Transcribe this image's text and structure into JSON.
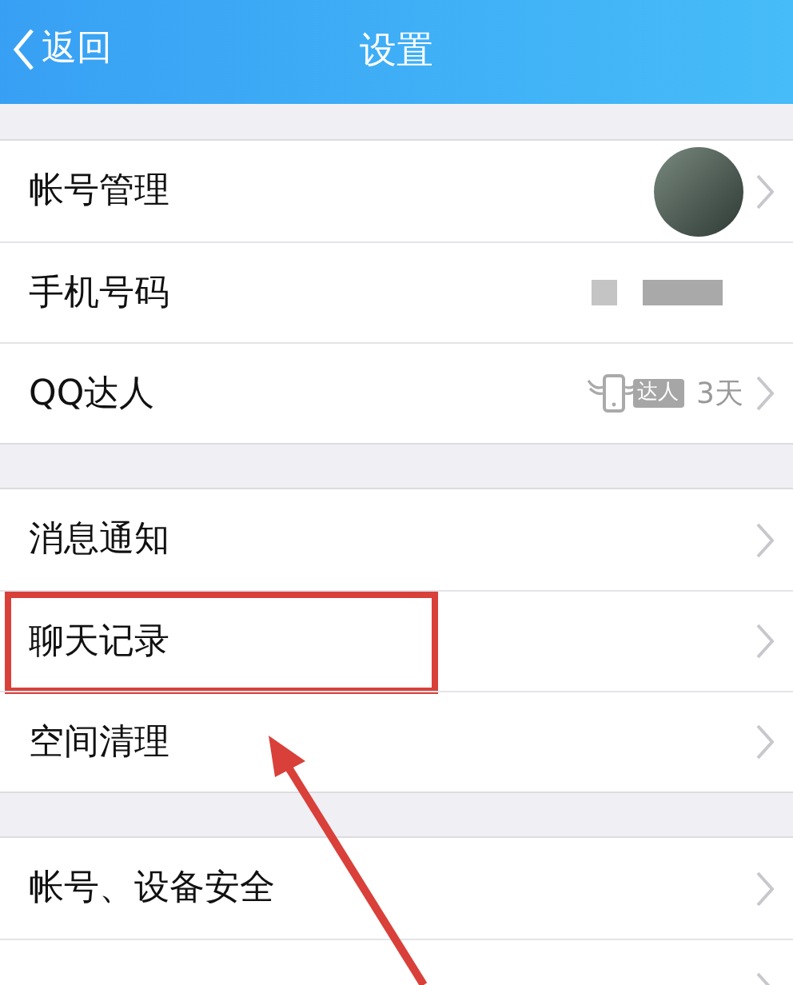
{
  "header": {
    "back_label": "返回",
    "title": "设置"
  },
  "groups": [
    [
      {
        "kind": "avatar",
        "label": "帐号管理",
        "highlighted": false
      },
      {
        "kind": "masked",
        "label": "手机号码",
        "highlighted": false
      },
      {
        "kind": "badge",
        "label": "QQ达人",
        "badge": "达人",
        "value": "3天",
        "highlighted": false
      }
    ],
    [
      {
        "kind": "plain",
        "label": "消息通知",
        "highlighted": false
      },
      {
        "kind": "plain",
        "label": "聊天记录",
        "highlighted": true
      },
      {
        "kind": "plain",
        "label": "空间清理",
        "highlighted": false
      }
    ],
    [
      {
        "kind": "plain",
        "label": "帐号、设备安全",
        "highlighted": false
      },
      {
        "kind": "plain",
        "highlighted": false
      }
    ]
  ]
}
